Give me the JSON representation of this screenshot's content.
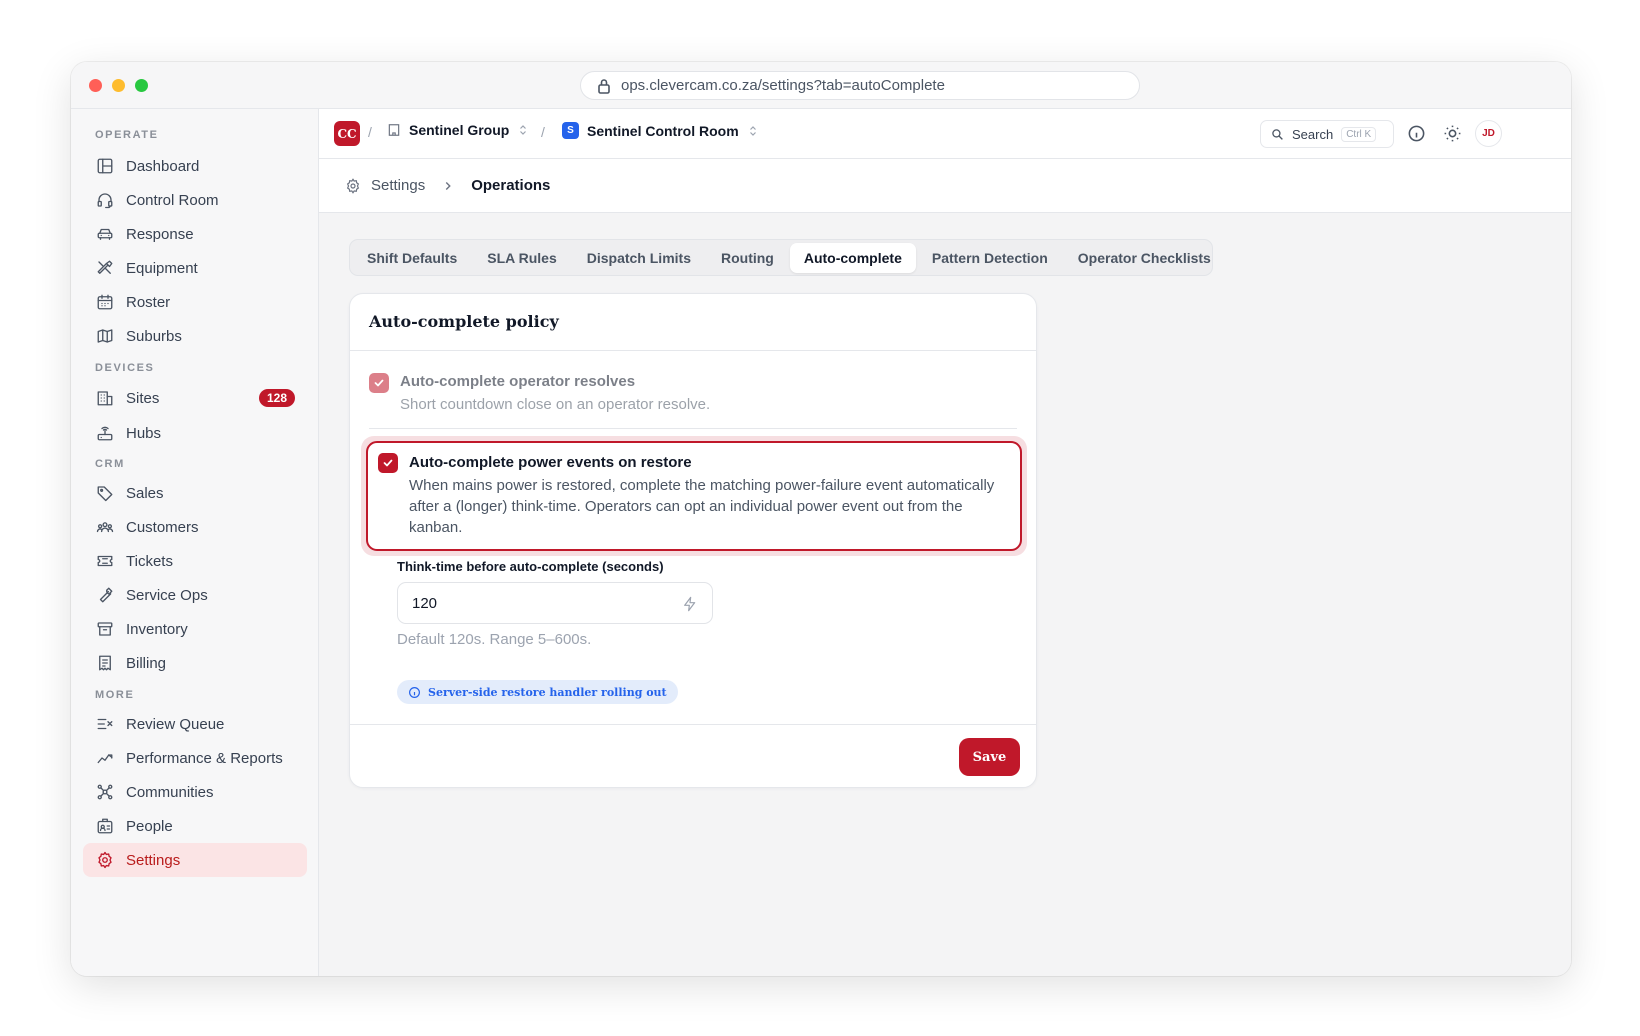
{
  "browser": {
    "url": "ops.clevercam.co.za/settings?tab=autoComplete"
  },
  "sidebar": {
    "sections": {
      "operate": "OPERATE",
      "devices": "DEVICES",
      "crm": "CRM",
      "more": "MORE"
    },
    "items": {
      "dashboard": "Dashboard",
      "control_room": "Control Room",
      "response": "Response",
      "equipment": "Equipment",
      "roster": "Roster",
      "suburbs": "Suburbs",
      "sites": "Sites",
      "sites_badge": "128",
      "hubs": "Hubs",
      "sales": "Sales",
      "customers": "Customers",
      "tickets": "Tickets",
      "service_ops": "Service Ops",
      "inventory": "Inventory",
      "billing": "Billing",
      "review_queue": "Review Queue",
      "performance_reports": "Performance & Reports",
      "communities": "Communities",
      "people": "People",
      "settings": "Settings"
    }
  },
  "header": {
    "org_logo": "CC",
    "separator": "/",
    "group": "Sentinel Group",
    "room_badge": "S",
    "room": "Sentinel Control Room",
    "search_label": "Search",
    "search_shortcut": "Ctrl K",
    "avatar": "JD"
  },
  "breadcrumb": {
    "parent": "Settings",
    "current": "Operations"
  },
  "tabs": [
    {
      "label": "Shift Defaults",
      "active": false
    },
    {
      "label": "SLA Rules",
      "active": false
    },
    {
      "label": "Dispatch Limits",
      "active": false
    },
    {
      "label": "Routing",
      "active": false
    },
    {
      "label": "Auto-complete",
      "active": true
    },
    {
      "label": "Pattern Detection",
      "active": false
    },
    {
      "label": "Operator Checklists",
      "active": false
    }
  ],
  "card": {
    "title": "Auto-complete policy",
    "option1": {
      "title": "Auto-complete operator resolves",
      "description": "Short countdown close on an operator resolve.",
      "checked": true
    },
    "option2": {
      "title": "Auto-complete power events on restore",
      "description": "When mains power is restored, complete the matching power-failure event automatically after a (longer) think-time. Operators can opt an individual power event out from the kanban.",
      "checked": true
    },
    "think_time": {
      "label": "Think-time before auto-complete (seconds)",
      "value": "120",
      "help": "Default 120s. Range 5–600s."
    },
    "info_pill": "Server-side restore handler rolling out",
    "save_label": "Save"
  },
  "colors": {
    "accent": "#c0182a",
    "info": "#2563eb"
  }
}
